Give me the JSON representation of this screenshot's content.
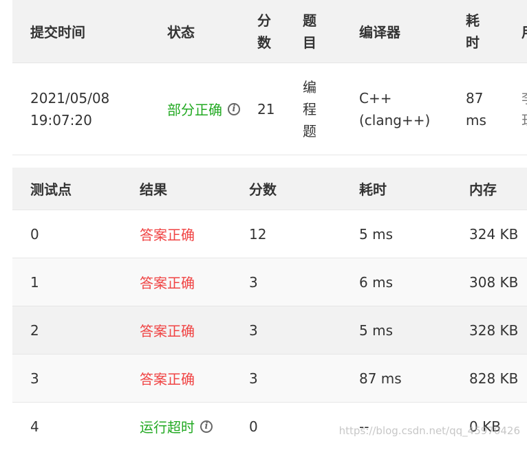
{
  "submission": {
    "headers": {
      "time": "提交时间",
      "status": "状态",
      "score_l1": "分",
      "score_l2": "数",
      "problem_l1": "题",
      "problem_l2": "目",
      "compiler": "编译器",
      "elapsed_l1": "耗",
      "elapsed_l2": "时",
      "cut": "用"
    },
    "row": {
      "date": "2021/05/08",
      "clock": "19:07:20",
      "status": "部分正确",
      "score": "21",
      "problem_l1": "编",
      "problem_l2": "程",
      "problem_l3": "题",
      "compiler_l1": "C++",
      "compiler_l2": "(clang++)",
      "time_l1": "87",
      "time_l2": "ms",
      "cut_l1": "李",
      "cut_l2": "珏"
    }
  },
  "tests": {
    "headers": {
      "point": "测试点",
      "result": "结果",
      "score": "分数",
      "time": "耗时",
      "memory": "内存"
    },
    "rows": [
      {
        "point": "0",
        "result": "答案正确",
        "score": "12",
        "time": "5 ms",
        "memory": "324 KB"
      },
      {
        "point": "1",
        "result": "答案正确",
        "score": "3",
        "time": "6 ms",
        "memory": "308 KB"
      },
      {
        "point": "2",
        "result": "答案正确",
        "score": "3",
        "time": "5 ms",
        "memory": "328 KB"
      },
      {
        "point": "3",
        "result": "答案正确",
        "score": "3",
        "time": "87 ms",
        "memory": "828 KB"
      },
      {
        "point": "4",
        "result": "运行超时",
        "score": "0",
        "time": "--",
        "memory": "0 KB"
      }
    ]
  },
  "watermark": "https://blog.csdn.net/qq_45970426",
  "colors": {
    "accepted": "#f04343",
    "partial": "#22a922",
    "timeout": "#22a922",
    "header_bg": "#f2f2f2"
  },
  "icons": {
    "status_info": "info-circle-icon",
    "timeout_info": "info-circle-icon"
  }
}
